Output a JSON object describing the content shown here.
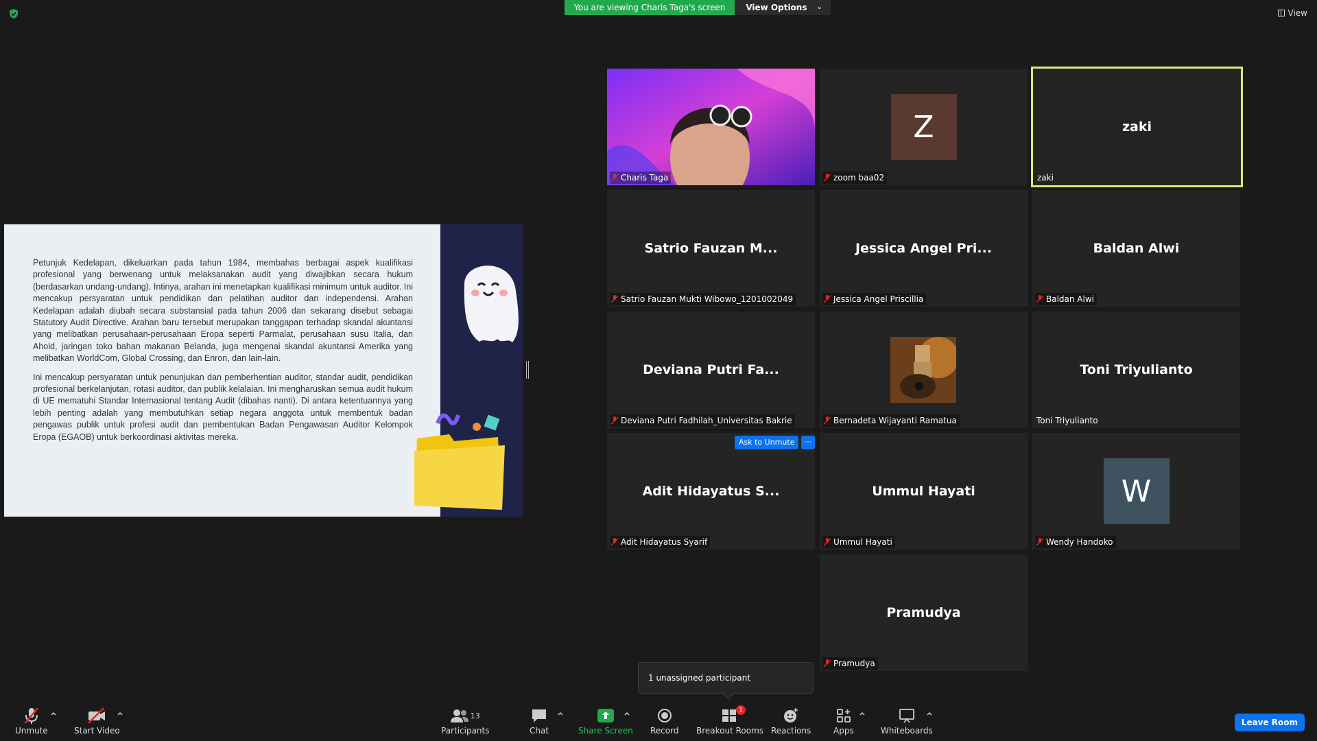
{
  "top": {
    "viewing_banner": "You are viewing Charis Taga's screen",
    "view_options": "View Options",
    "view_label": "View"
  },
  "slide": {
    "paragraph1": "Petunjuk Kedelapan, dikeluarkan pada tahun 1984, membahas berbagai aspek kualifikasi profesional yang berwenang untuk melaksanakan audit yang diwajibkan secara hukum (berdasarkan undang-undang). Intinya, arahan ini menetapkan kualifikasi minimum untuk auditor. Ini mencakup persyaratan untuk pendidikan dan pelatihan auditor dan independensi. Arahan Kedelapan adalah diubah secara substansial pada tahun 2006 dan sekarang disebut sebagai Statutory Audit Directive. Arahan baru tersebut merupakan tanggapan terhadap skandal akuntansi yang melibatkan perusahaan-perusahaan Eropa seperti Parmalat, perusahaan susu Italia, dan Ahold, jaringan toko bahan makanan Belanda, juga mengenai skandal akuntansi Amerika yang melibatkan WorldCom, Global Crossing, dan Enron, dan lain-lain.",
    "paragraph2": "Ini mencakup persyaratan untuk penunjukan dan pemberhentian auditor, standar audit, pendidikan profesional berkelanjutan, rotasi auditor, dan publik kelalaian. Ini mengharuskan semua audit hukum di UE mematuhi Standar Internasional tentang Audit (dibahas nanti). Di antara ketentuannya yang lebih penting adalah yang membutuhkan setiap negara anggota untuk membentuk badan pengawas publik untuk profesi audit dan pembentukan Badan Pengawasan Auditor Kelompok Eropa (EGAOB) untuk berkoordinasi aktivitas mereka."
  },
  "gallery": {
    "tiles": [
      {
        "caption": "Charis Taga"
      },
      {
        "caption": "zoom baa02",
        "initial": "Z",
        "avatar_color": "#5a3a30"
      },
      {
        "big_name": "zaki",
        "caption": "zaki"
      },
      {
        "big_name": "Satrio Fauzan M...",
        "caption": "Satrio Fauzan Mukti Wibowo_1201002049"
      },
      {
        "big_name": "Jessica Angel Pri...",
        "caption": "Jessica Angel Priscillia"
      },
      {
        "big_name": "Baldan Alwi",
        "caption": "Baldan Alwi"
      },
      {
        "big_name": "Deviana Putri Fa...",
        "caption": "Deviana Putri Fadhilah_Universitas Bakrie"
      },
      {
        "caption": "Bernadeta Wijayanti Ramatua"
      },
      {
        "big_name": "Toni Triyulianto",
        "caption": "Toni Triyulianto"
      },
      {
        "big_name": "Adit Hidayatus S...",
        "caption": "Adit Hidayatus Syarif",
        "ask_unmute": "Ask to Unmute",
        "more": "···"
      },
      {
        "big_name": "Ummul Hayati",
        "caption": "Ummul Hayati"
      },
      {
        "caption": "Wendy Handoko",
        "initial": "W",
        "avatar_color": "#3f5260"
      },
      {
        "big_name": "Pramudya",
        "caption": "Pramudya"
      }
    ]
  },
  "tooltip": {
    "unassigned": "1 unassigned participant"
  },
  "toolbar": {
    "unmute": "Unmute",
    "start_video": "Start Video",
    "participants": "Participants",
    "participants_count": "13",
    "chat": "Chat",
    "share_screen": "Share Screen",
    "record": "Record",
    "breakout_rooms": "Breakout Rooms",
    "breakout_badge": "1",
    "reactions": "Reactions",
    "apps": "Apps",
    "whiteboards": "Whiteboards",
    "leave_room": "Leave Room"
  },
  "colors": {
    "share_green": "#23a94d",
    "accent_blue": "#0e72ed",
    "active_speaker": "#d8ec7a",
    "mute_red": "#e02828"
  }
}
